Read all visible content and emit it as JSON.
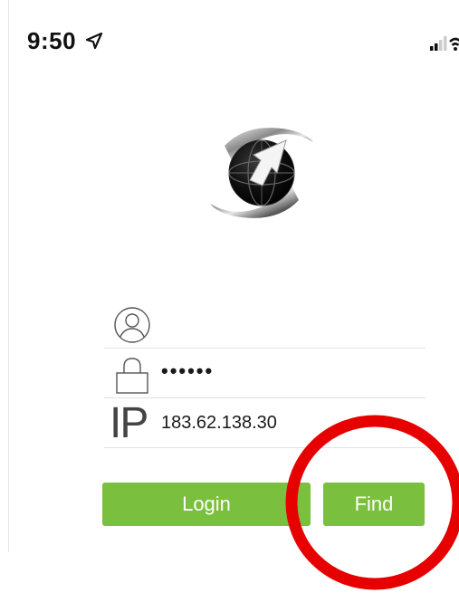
{
  "status_bar": {
    "time": "9:50",
    "location_icon": "location-arrow-icon",
    "signal_icon": "signal-wifi-icon"
  },
  "logo": {
    "icon": "app-logo"
  },
  "form": {
    "username": {
      "icon": "user-icon",
      "value": ""
    },
    "password": {
      "icon": "lock-icon",
      "value": "••••••"
    },
    "ip": {
      "label": "IP",
      "value": "183.62.138.30"
    }
  },
  "buttons": {
    "login_label": "Login",
    "find_label": "Find"
  },
  "colors": {
    "button_green": "#7bbf3e",
    "highlight_red": "#e60000",
    "divider": "#e3e3e3"
  }
}
